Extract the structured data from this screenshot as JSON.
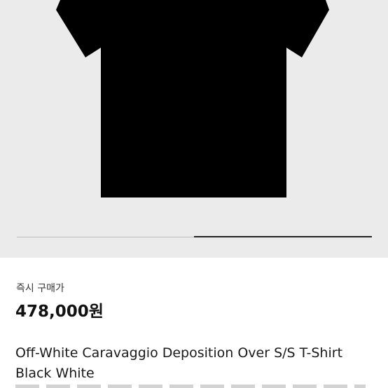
{
  "purchase": {
    "price_label": "즉시 구매가",
    "price": "478,000원"
  },
  "product": {
    "title": "Off-White Caravaggio Deposition Over S/S T-Shirt Black White",
    "image_icon": "tshirt-icon",
    "image_color": "#000000"
  },
  "carousel": {
    "position_fraction": 0.5
  },
  "colors": {
    "image_background": "#ebebeb",
    "page_background": "#ffffff"
  }
}
